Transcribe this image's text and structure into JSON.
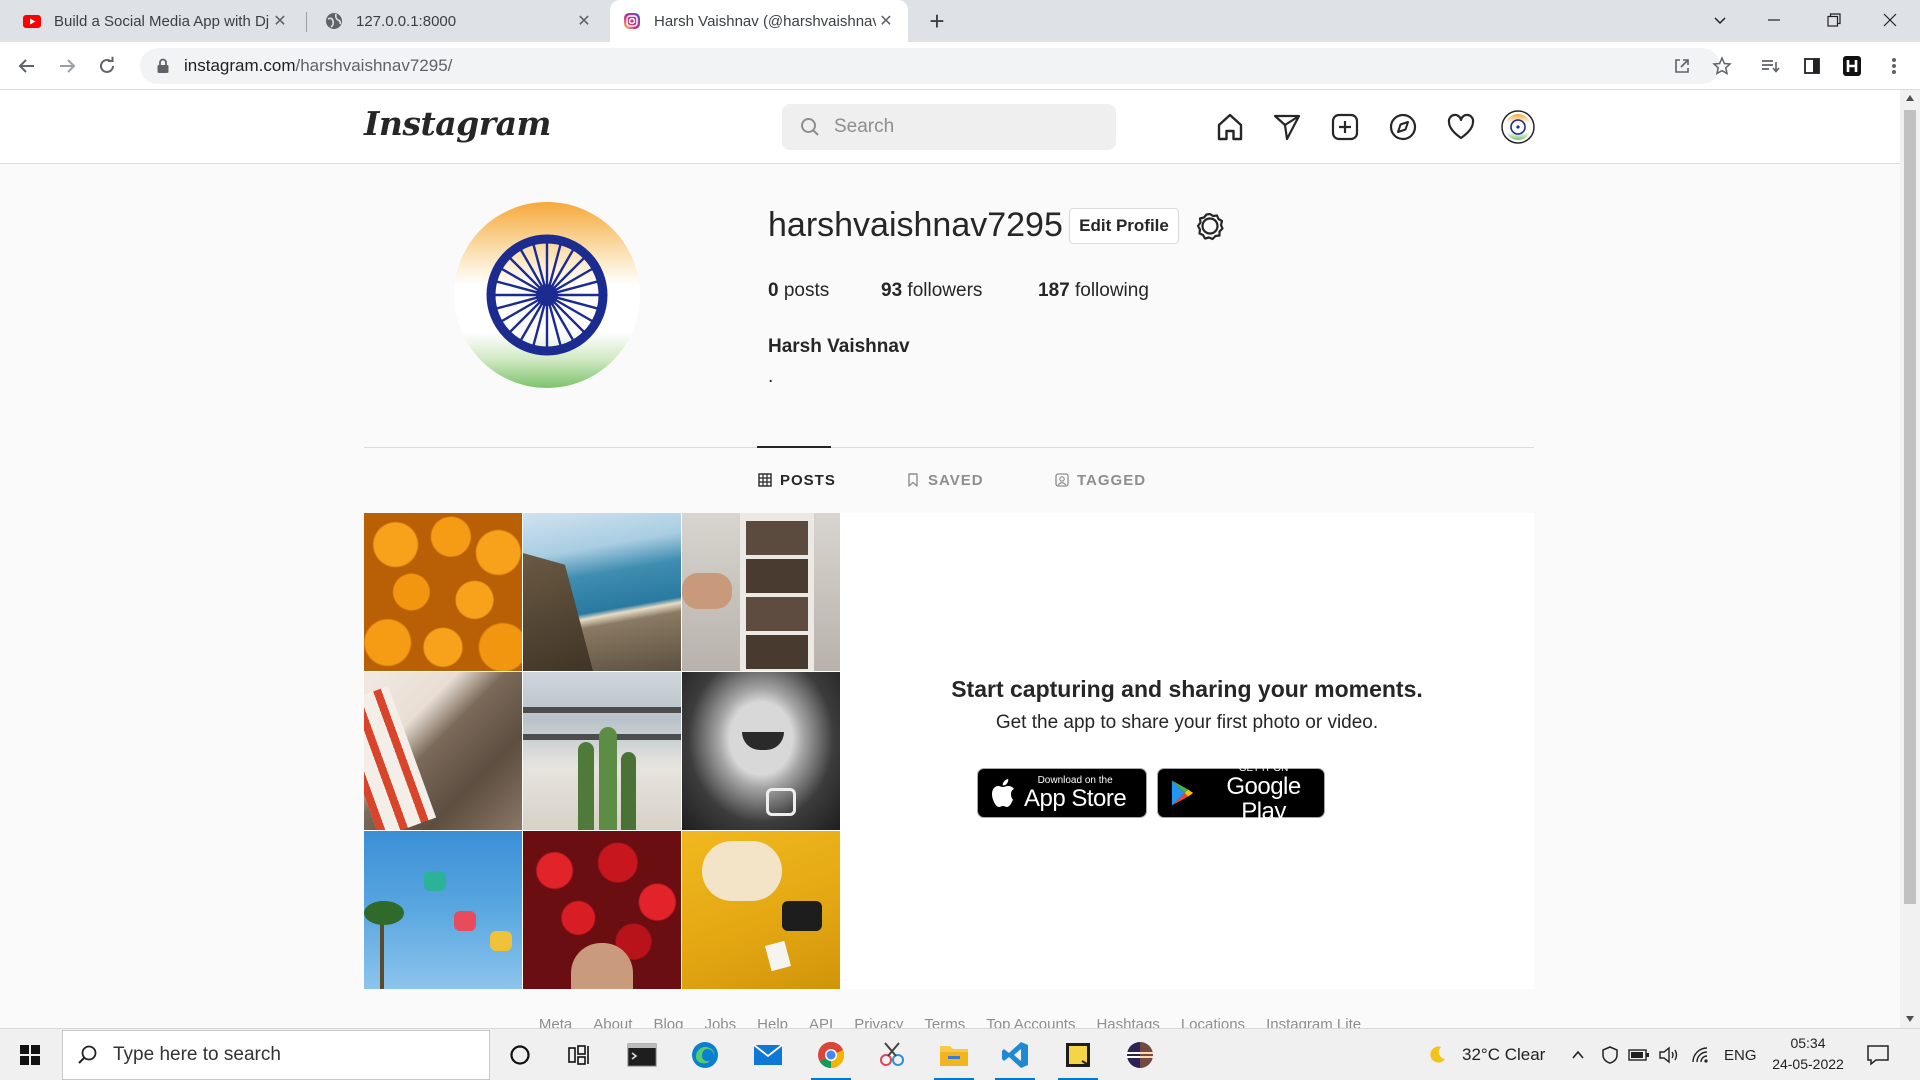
{
  "browser": {
    "tabs": [
      {
        "title": "Build a Social Media App with Dj",
        "favicon": "youtube-icon",
        "active": false
      },
      {
        "title": "127.0.0.1:8000",
        "favicon": "globe-icon",
        "active": false
      },
      {
        "title": "Harsh Vaishnav (@harshvaishnav",
        "favicon": "instagram-icon",
        "active": true
      }
    ],
    "url_host": "instagram.com",
    "url_path": "/harshvaishnav7295/"
  },
  "ig": {
    "logo": "Instagram",
    "search_placeholder": "Search"
  },
  "profile": {
    "username": "harshvaishnav7295",
    "edit_label": "Edit Profile",
    "posts_count": "0",
    "posts_label": "posts",
    "followers_count": "93",
    "followers_label": "followers",
    "following_count": "187",
    "following_label": "following",
    "full_name": "Harsh Vaishnav",
    "bio": "."
  },
  "profile_tabs": [
    {
      "label": "POSTS",
      "icon": "grid-icon",
      "active": true
    },
    {
      "label": "SAVED",
      "icon": "bookmark-icon",
      "active": false
    },
    {
      "label": "TAGGED",
      "icon": "tag-person-icon",
      "active": false
    }
  ],
  "empty_state": {
    "title": "Start capturing and sharing your moments.",
    "subtitle": "Get the app to share your first photo or video.",
    "app_store_small": "Download on the",
    "app_store_big": "App Store",
    "google_play_small": "GET IT ON",
    "google_play_big": "Google Play"
  },
  "footer_links": [
    "Meta",
    "About",
    "Blog",
    "Jobs",
    "Help",
    "API",
    "Privacy",
    "Terms",
    "Top Accounts",
    "Hashtags",
    "Locations",
    "Instagram Lite"
  ],
  "taskbar": {
    "search_placeholder": "Type here to search",
    "weather": "32°C  Clear",
    "language": "ENG",
    "time": "05:34",
    "date": "24-05-2022"
  },
  "colors": {
    "accent": "#0095f6",
    "chakra": "#1c2b8f",
    "saffron": "#f6a93b",
    "green": "#7cc36b"
  }
}
